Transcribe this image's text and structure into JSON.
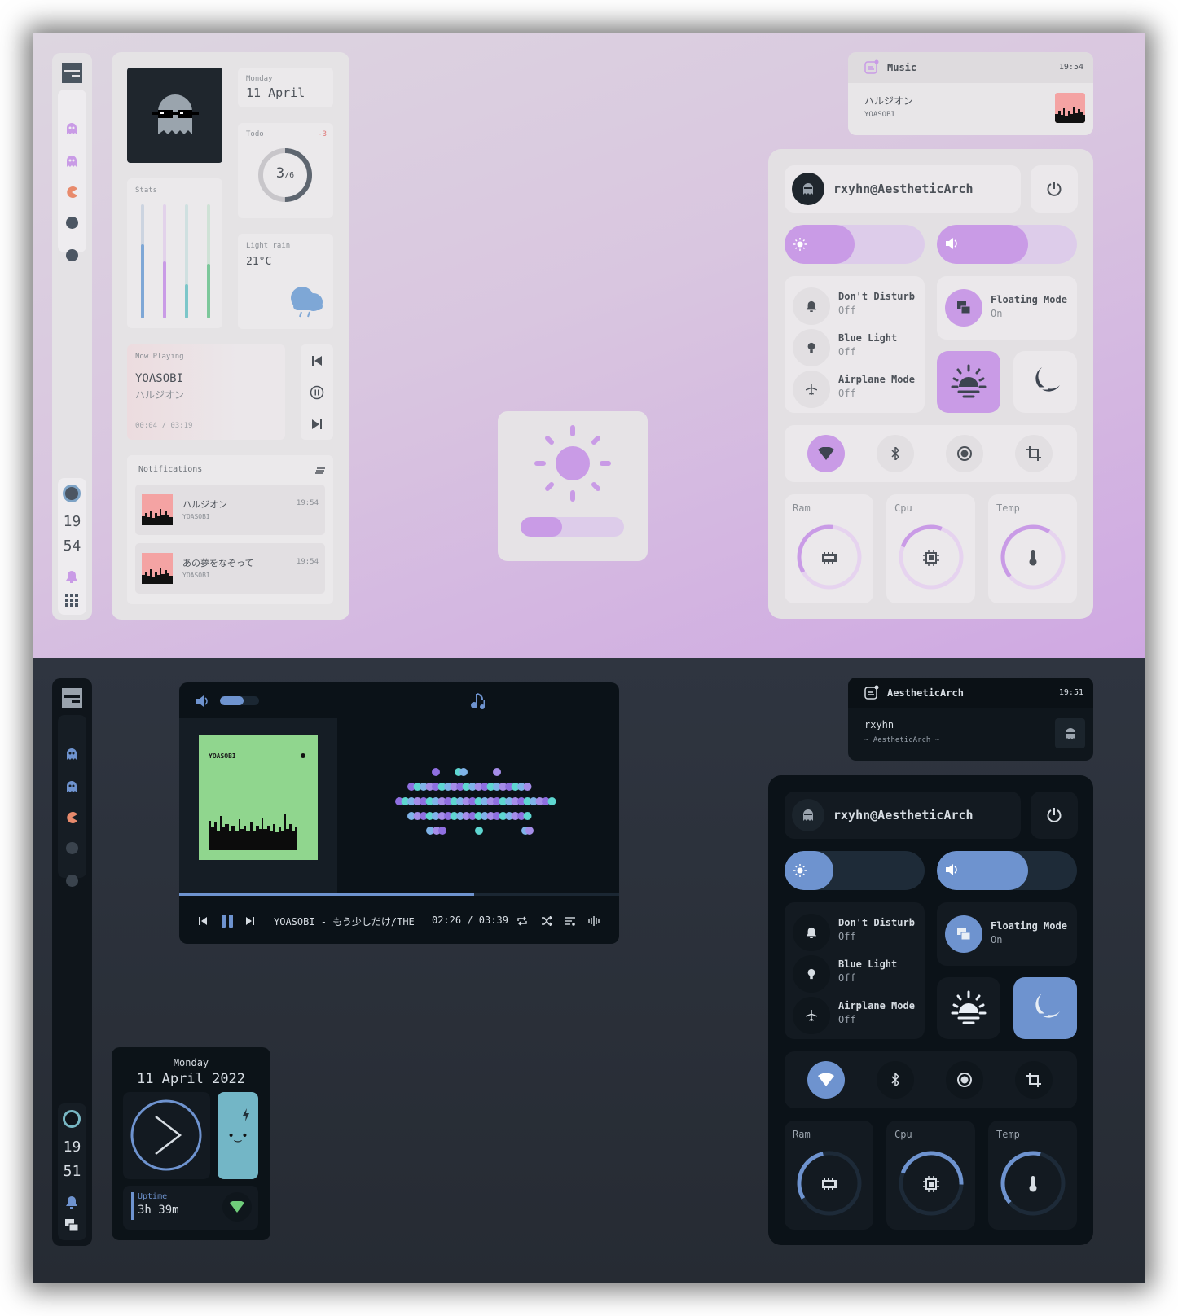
{
  "colors": {
    "accent_light": "#c99be6",
    "accent_dark": "#6e93cf",
    "text_light": "#4c5158",
    "text_dark": "#d7dde3",
    "muted": "#8b8f95"
  },
  "light": {
    "sidebar": {
      "icons": [
        "ghost-icon",
        "ghost-icon",
        "pacman-icon",
        "dot-icon",
        "dot-icon"
      ],
      "clock_hour": "19",
      "clock_min": "54"
    },
    "dashboard": {
      "date_day": "Monday",
      "date": "11 April",
      "todo_label": "Todo",
      "todo_delta": "-3",
      "todo_done": "3",
      "todo_total": "/6",
      "todo_fraction": 0.5,
      "stats_label": "Stats",
      "stats_levels": [
        0.65,
        0.5,
        0.3,
        0.48
      ],
      "weather_desc": "Light rain",
      "weather_temp": "21°C",
      "np_label": "Now Playing",
      "np_artist": "YOASOBI",
      "np_title": "ハルジオン",
      "np_time": "00:04 / 03:19",
      "notif_label": "Notifications",
      "notifications": [
        {
          "title": "ハルジオン",
          "subtitle": "YOASOBI",
          "time": "19:54"
        },
        {
          "title": "あの夢をなぞって",
          "subtitle": "YOASOBI",
          "time": "19:54"
        }
      ]
    },
    "popup": {
      "app": "Music",
      "time": "19:54",
      "title": "ハルジオン",
      "subtitle": "YOASOBI"
    },
    "brightness_osd_level": 0.4,
    "control": {
      "user": "rxyhn@AestheticArch",
      "brightness": 0.5,
      "volume": 0.65,
      "toggles": [
        {
          "name": "Don't Disturb",
          "state": "Off"
        },
        {
          "name": "Blue Light",
          "state": "Off"
        },
        {
          "name": "Airplane Mode",
          "state": "Off"
        }
      ],
      "floating_name": "Floating Mode",
      "floating_state": "On",
      "monitors": [
        {
          "label": "Ram",
          "value": 0.35
        },
        {
          "label": "Cpu",
          "value": 0.25
        },
        {
          "label": "Temp",
          "value": 0.45
        }
      ]
    }
  },
  "dark": {
    "sidebar": {
      "clock_hour": "19",
      "clock_min": "51"
    },
    "player": {
      "track": "YOASOBI - もう少しだけ/THE",
      "time": "02:26 / 03:39",
      "volume": 0.6,
      "progress": 0.67,
      "album_text": "YOASOBI"
    },
    "popup": {
      "app": "AestheticArch",
      "time": "19:51",
      "title": "rxyhn",
      "subtitle": "~ AestheticArch ~"
    },
    "clock_widget": {
      "day": "Monday",
      "date": "11 April 2022",
      "uptime_label": "Uptime",
      "uptime": "3h 39m"
    },
    "control": {
      "user": "rxyhn@AestheticArch",
      "brightness": 0.35,
      "volume": 0.65,
      "toggles": [
        {
          "name": "Don't Disturb",
          "state": "Off"
        },
        {
          "name": "Blue Light",
          "state": "Off"
        },
        {
          "name": "Airplane Mode",
          "state": "Off"
        }
      ],
      "floating_name": "Floating Mode",
      "floating_state": "On",
      "monitors": [
        {
          "label": "Ram",
          "value": 0.3
        },
        {
          "label": "Cpu",
          "value": 0.45
        },
        {
          "label": "Temp",
          "value": 0.4
        }
      ]
    }
  }
}
